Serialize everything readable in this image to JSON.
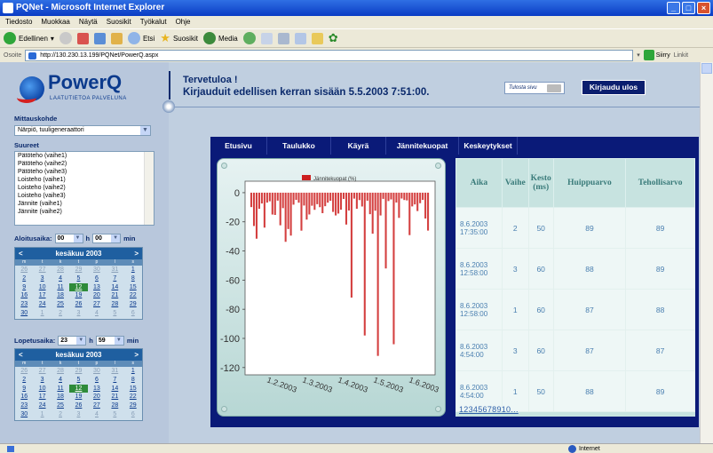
{
  "window": {
    "title": "PQNet - Microsoft Internet Explorer"
  },
  "menu": [
    "Tiedosto",
    "Muokkaa",
    "Näytä",
    "Suosikit",
    "Työkalut",
    "Ohje"
  ],
  "toolbar": {
    "back": "Edellinen",
    "search": "Etsi",
    "favorites": "Suosikit",
    "media": "Media"
  },
  "address": {
    "label": "Osoite",
    "url": "http://130.230.13.199/PQNet/PowerQ.aspx",
    "go": "Siirry",
    "links": "Linkit"
  },
  "logo": {
    "name": "PowerQ",
    "tagline": "LAATUTIETOA PALVELUNA"
  },
  "header": {
    "welcome": "Tervetuloa !",
    "last_login": "Kirjauduit edellisen kerran sisään 5.5.2003 7:51:00.",
    "print": "Tulosta sivu",
    "logout": "Kirjaudu ulos"
  },
  "sidebar": {
    "site_label": "Mittauskohde",
    "site_value": "Närpiö, tuuligeneraattori",
    "params_label": "Suureet",
    "params": [
      "Pätöteho (vaihe1)",
      "Pätöteho (vaihe2)",
      "Pätöteho (vaihe3)",
      "Loisteho (vaihe1)",
      "Loisteho (vaihe2)",
      "Loisteho (vaihe3)",
      "Jännite (vaihe1)",
      "Jännite (vaihe2)"
    ],
    "start_label": "Aloitusaika:",
    "start_h": "00",
    "start_m": "00",
    "end_label": "Lopetusaika:",
    "end_h": "23",
    "end_m": "59",
    "h": "h",
    "min": "min",
    "cal_month": "kesäkuu 2003",
    "cal_prev": "<",
    "cal_next": ">",
    "weekdays": [
      "m",
      "t",
      "k",
      "t",
      "p",
      "l",
      "s"
    ]
  },
  "tabs": [
    "Etusivu",
    "Taulukko",
    "Käyrä",
    "Jännitekuopat",
    "Keskeytykset"
  ],
  "chart_data": {
    "type": "bar",
    "legend": "Jännitekuopat (%)",
    "yticks": [
      0,
      -20,
      -40,
      -60,
      -80,
      -100,
      -120
    ],
    "ylim": [
      -125,
      3
    ],
    "xticks": [
      "1.2.2003",
      "1.3.2003",
      "1.4.2003",
      "1.5.2003",
      "1.6.2003"
    ],
    "color": "#cc1f1f"
  },
  "table": {
    "headers": [
      "Aika",
      "Vaihe",
      "Kesto (ms)",
      "Huippuarvo",
      "Tehollisarvo"
    ],
    "rows": [
      [
        "8.6.2003 17:35:00",
        "2",
        "50",
        "89",
        "89"
      ],
      [
        "8.6.2003 12:58:00",
        "3",
        "60",
        "88",
        "89"
      ],
      [
        "8.6.2003 12:58:00",
        "1",
        "60",
        "87",
        "88"
      ],
      [
        "8.6.2003 4:54:00",
        "3",
        "60",
        "87",
        "87"
      ],
      [
        "8.6.2003 4:54:00",
        "1",
        "50",
        "88",
        "89"
      ]
    ],
    "pager": "12345678910..."
  },
  "status": {
    "zone": "Internet"
  }
}
